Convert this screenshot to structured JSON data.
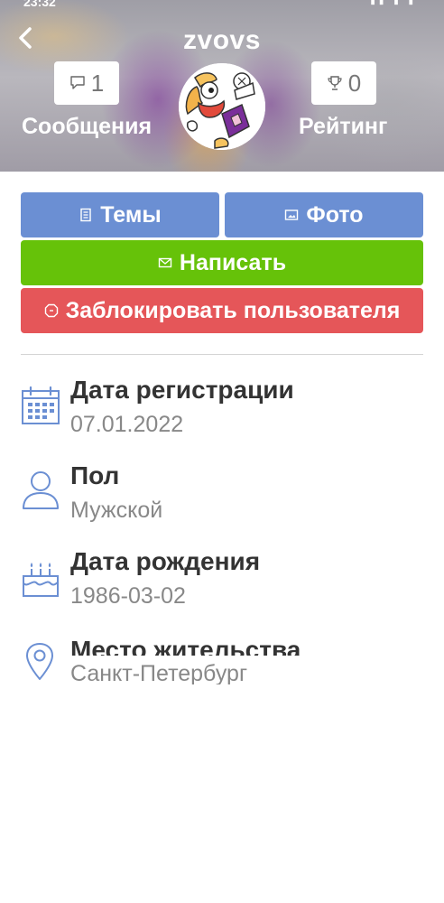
{
  "status_bar": {
    "time": "23:32",
    "icons": [
      "signal-icon",
      "wifi-icon",
      "battery-icon"
    ]
  },
  "profile": {
    "username": "zvovs",
    "messages_count": "1",
    "messages_label": "Сообщения",
    "rating_count": "0",
    "rating_label": "Рейтинг"
  },
  "actions": {
    "topics_label": "Темы",
    "photos_label": "Фото",
    "write_label": "Написать",
    "block_label": "Заблокировать пользователя"
  },
  "info": [
    {
      "icon": "calendar-icon",
      "label": "Дата регистрации",
      "value": "07.01.2022"
    },
    {
      "icon": "person-icon",
      "label": "Пол",
      "value": "Мужской"
    },
    {
      "icon": "cake-icon",
      "label": "Дата рождения",
      "value": "1986-03-02"
    },
    {
      "icon": "location-pin-icon",
      "label": "Место жительства",
      "value": "Санкт-Петербург"
    }
  ],
  "colors": {
    "primary_button": "#6b8fd3",
    "write_button": "#66c209",
    "block_button": "#e55659",
    "icon_blue": "#6b8fd3"
  }
}
